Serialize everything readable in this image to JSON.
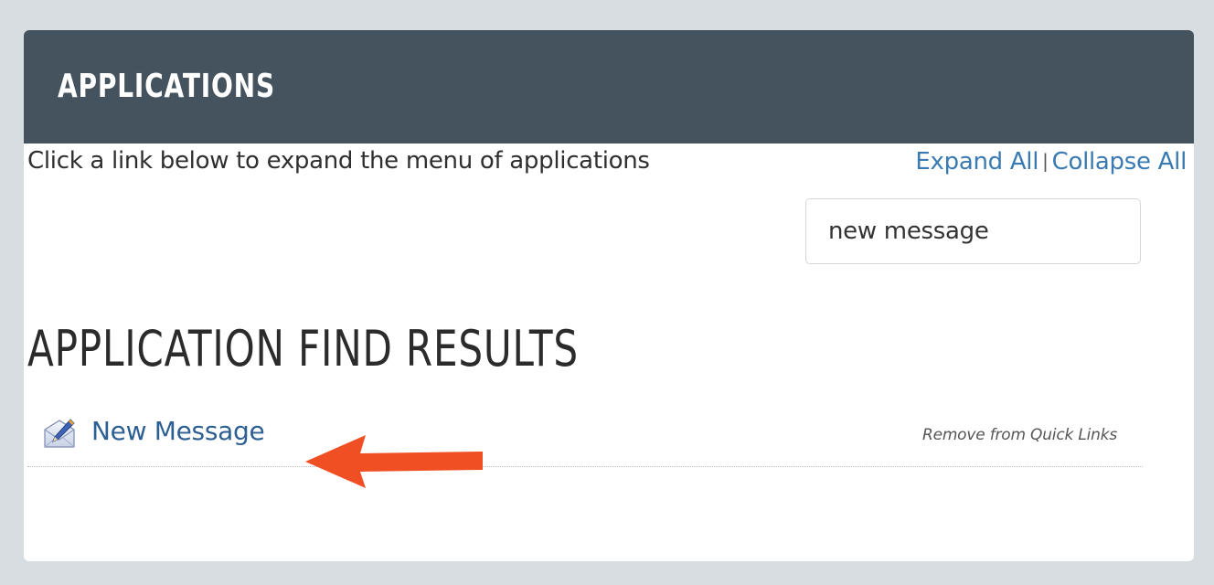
{
  "header": {
    "title": "APPLICATIONS"
  },
  "intro": {
    "text": "Click a link below to expand the menu of applications"
  },
  "toggles": {
    "expand_all": "Expand All",
    "separator": "|",
    "collapse_all": "Collapse All"
  },
  "search": {
    "value": "new message"
  },
  "results": {
    "heading": "APPLICATION FIND RESULTS",
    "items": [
      {
        "label": "New Message",
        "icon": "envelope-pen-icon",
        "action": "Remove from Quick Links"
      }
    ]
  },
  "annotation": {
    "arrow_color": "#f04e23",
    "arrow_icon": "arrow-left-icon"
  },
  "colors": {
    "header_bg": "#45535e",
    "link": "#3a7ab3",
    "page_bg": "#d8dde2"
  }
}
